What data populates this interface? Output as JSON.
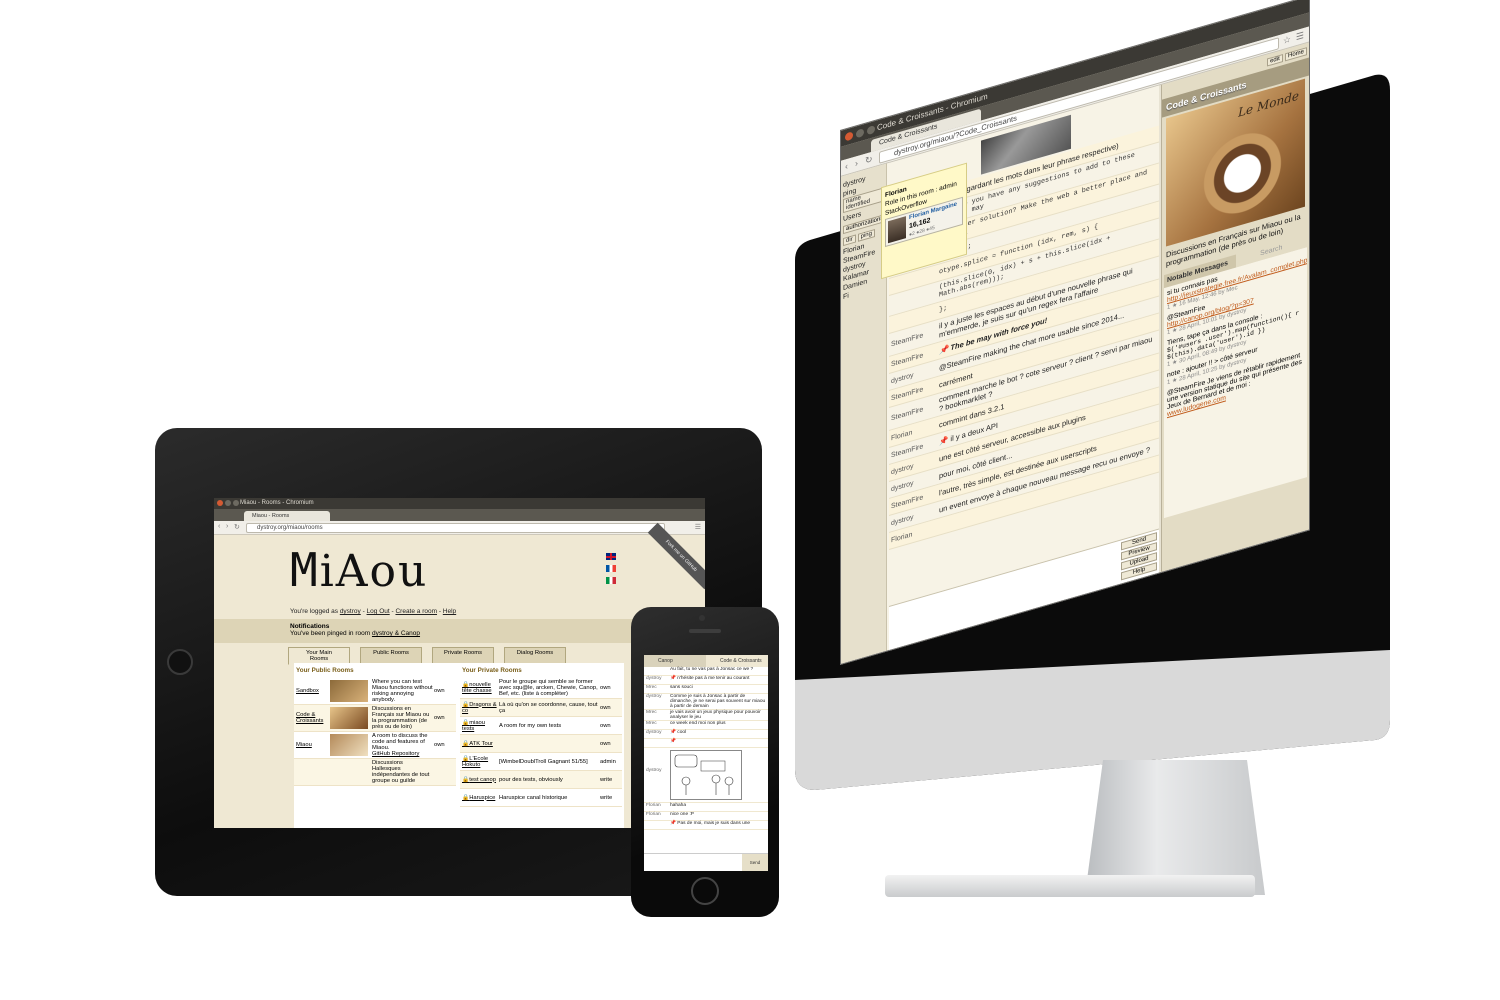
{
  "desktop": {
    "window_title": "Code & Croissants - Chromium",
    "tab_title": "Code & Croissants",
    "url": "dystroy.org/miaou/?Code_Croissants",
    "left": {
      "user": "dystroy",
      "ping": "ping",
      "btn_name_identified": "name identified",
      "users_label": "Users",
      "btn_authorizations": "authorizations",
      "btn_dir": "dir",
      "btn_ping": "ping",
      "users": [
        "Florian",
        "SteamFire",
        "dystroy",
        "Kalamar",
        "Damien",
        "Fi"
      ]
    },
    "profile": {
      "name": "Florian",
      "role": "Role in this room : admin",
      "so": "StackOverflow",
      "so_name": "Florian Margaine",
      "so_rep": "16,162",
      "so_badges": "●2 ●28 ●45"
    },
    "messages": [
      {
        "author": "",
        "text": "(tout en gardant les mots dans leur phrase respective)",
        "style": ""
      },
      {
        "author": "SteamFire",
        "text": "s = \"Do you have any suggestions to add to these test or may",
        "style": "code"
      },
      {
        "author": "",
        "text": "en faster solution? Make the web a better place and share i",
        "style": "code"
      },
      {
        "author": "",
        "text": "ments!\";",
        "style": "code"
      },
      {
        "author": "",
        "text": "otype.splice = function (idx, rem, s) {",
        "style": "code"
      },
      {
        "author": "",
        "text": "(this.slice(0, idx) + s + this.slice(idx + Math.abs(rem)));",
        "style": "code"
      },
      {
        "author": "",
        "text": "};",
        "style": "code"
      },
      {
        "author": "SteamFire",
        "text": "il y a juste les espaces au début d'une nouvelle phrase qui m'emmerde, je suis sur qu'un regex fera l'affaire",
        "style": ""
      },
      {
        "author": "SteamFire",
        "text": "📌 The be may with force you!",
        "style": "bold"
      },
      {
        "author": "dystroy",
        "text": "@SteamFire making the chat more usable since 2014...",
        "style": ""
      },
      {
        "author": "SteamFire",
        "text": "carrément",
        "style": ""
      },
      {
        "author": "SteamFire",
        "text": "comment marche le bot ? cote serveur ? client ? servi par miaou ? bookmarklet ?",
        "style": ""
      },
      {
        "author": "Florian",
        "text": "commint dans 3.2.1",
        "style": ""
      },
      {
        "author": "SteamFire",
        "text": "📌 il y a deux API",
        "style": ""
      },
      {
        "author": "dystroy",
        "text": "une est côté serveur, accessible aux plugins",
        "style": ""
      },
      {
        "author": "dystroy",
        "text": "pour moi, côté client...",
        "style": ""
      },
      {
        "author": "SteamFire",
        "text": "l'autre, très simple, est destinée aux userscripts",
        "style": ""
      },
      {
        "author": "dystroy",
        "text": "un event envoye à chaque nouveau message recu ou envoye ?",
        "style": ""
      },
      {
        "author": "Florian",
        "text": "",
        "style": ""
      }
    ],
    "input_buttons": [
      "Send",
      "Preview",
      "Upload",
      "Help"
    ],
    "room": {
      "edit_btn": "edit",
      "home_btn": "Home",
      "title": "Code & Croissants",
      "image_text": "Le Monde",
      "description": "Discussions en Français sur Miaou ou la programmation (de près ou de loin)",
      "tab_notable": "Notable Messages",
      "tab_search": "Search",
      "notable": [
        {
          "text": "si tu connais pas",
          "link": "http://jeuxstrategie.free.fr/Avalam_complet.php#R",
          "meta": "1 ★ 16 May, 12:46 by Mec"
        },
        {
          "text": "@SteamFire",
          "link": "http://canop.org/blog/?p=307",
          "meta": "1 ★ 28 April, 10:01 by dystroy"
        },
        {
          "text": "Tiens, tape ça dans la console :",
          "code": "$('#users .user').map(function(){ r $(this).data('user').id })",
          "meta": "1 ★ 30 April, 08:49 by dystroy"
        },
        {
          "text": "note : ajouter !! > côté serveur",
          "meta": "1 ★ 28 April, 10:25 by dystroy"
        },
        {
          "text": "@SteamFire Je viens de rétablir rapidement une version statique du site qui présente des Jeux de Bernard et de moi :",
          "link": "www.ludogene.com"
        }
      ]
    }
  },
  "tablet": {
    "window_title": "Miaou - Rooms - Chromium",
    "tab_title": "Miaou - Rooms",
    "url": "dystroy.org/miaou/rooms",
    "logo": "iAou",
    "ribbon": "Fork me on GitHub",
    "login_prefix": "You're logged as",
    "login_user": "dystroy",
    "logout": "Log Out",
    "create_room": "Create a room",
    "help": "Help",
    "notifications_title": "Notifications",
    "notification_text": "You've been pinged in room",
    "notification_room": "dystroy & Canop",
    "tabs": [
      "Your Main Rooms",
      "Public Rooms",
      "Private Rooms",
      "Dialog Rooms"
    ],
    "public_header": "Your Public Rooms",
    "private_header": "Your Private Rooms",
    "public_rooms": [
      {
        "name": "Sandbox",
        "desc": "Where you can test Miaou functions without risking annoying anybody.",
        "auth": "own"
      },
      {
        "name": "Code & Croissants",
        "desc": "Discussions en Français sur Miaou ou la programmation (de près ou de loin)",
        "auth": "own"
      },
      {
        "name": "Miaou",
        "desc": "A room to discuss the code and features of Miaou.",
        "link": "GitHub Repository",
        "auth": "own"
      },
      {
        "name": "",
        "desc": "Discussions Hallesques indépendantes de tout groupe ou guilde",
        "auth": ""
      }
    ],
    "private_rooms": [
      {
        "name": "nouvelle tête chasse",
        "desc": "Pour le groupe qui semble se former avec squ@le, arcken, Chewie, Canop, Bef, etc. (liste à compléter)",
        "auth": "own"
      },
      {
        "name": "Dragons & co",
        "desc": "Là où qu'on se coordonne, cause, tout ça",
        "auth": "own"
      },
      {
        "name": "miaou tests",
        "desc": "A room for my own tests",
        "auth": "own"
      },
      {
        "name": "ATK Tour",
        "desc": "",
        "auth": "own"
      },
      {
        "name": "L'Ecole Hokuto",
        "desc": "[WimbelDoublTroll Gagnant 51/55]",
        "auth": "admin"
      },
      {
        "name": "test canop",
        "desc": "pour des tests, obviously",
        "auth": "write"
      },
      {
        "name": "Haruspice",
        "desc": "Haruspice canal historique",
        "auth": "write"
      }
    ]
  },
  "phone": {
    "tabs": [
      "Canop",
      "Code & Croissants"
    ],
    "messages": [
      {
        "author": "",
        "text": "Au fait, tu ne vas pas à Jonsac ce we ?"
      },
      {
        "author": "dystroy",
        "text": "📌 n'hésite pas à me tenir au courant"
      },
      {
        "author": "Mrec",
        "text": "sans souci"
      },
      {
        "author": "dystroy",
        "text": "Comme je suis à Jonsac à partir de dimanche, je ne serai pas souvent sur miaou à partir de demain"
      },
      {
        "author": "Mrec",
        "text": "je vais avoir un jeux physique pour pouvoir analyser le jeu"
      },
      {
        "author": "Mrec",
        "text": "ce week end moi non plus"
      },
      {
        "author": "dystroy",
        "text": "📌 cool"
      },
      {
        "author": "",
        "text": "📌"
      },
      {
        "author": "Florian",
        "text": "hahaha"
      },
      {
        "author": "Florian",
        "text": "nice one :P"
      },
      {
        "author": "",
        "text": "📌 Pas de moi, mais je suis dans une"
      }
    ],
    "comic_author": "dystroy",
    "send": "Send"
  },
  "colors": {
    "chrome_dark": "#3b3934",
    "paper": "#efe8d3",
    "accent_link": "#c05a1a"
  }
}
